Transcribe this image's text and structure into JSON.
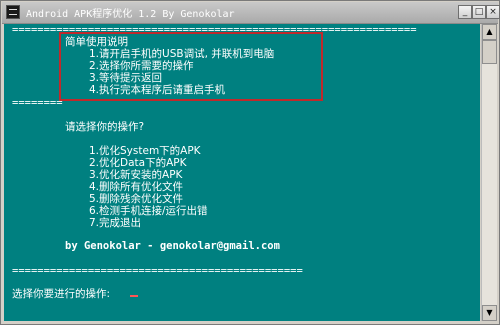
{
  "window": {
    "title": "Android APK程序优化 1.2 By Genokolar",
    "icon": "console-icon",
    "controls": {
      "minimize": "_",
      "maximize": "□",
      "close": "×"
    }
  },
  "console": {
    "separator_top": "================================================================",
    "instructions": {
      "heading": "简单使用说明",
      "steps": [
        "1.请开启手机的USB调试, 并联机到电脑",
        "2.选择你所需要的操作",
        "3.等待提示返回",
        "4.执行完本程序后请重启手机"
      ]
    },
    "separator_short": "========",
    "prompt_title": "请选择你的操作?",
    "options": [
      "1.优化System下的APK",
      "2.优化Data下的APK",
      "3.优化新安装的APK",
      "4.删除所有优化文件",
      "5.删除残余优化文件",
      "6.检测手机连接/运行出错",
      "7.完成退出"
    ],
    "author_line": "by Genokolar - genokolar@gmail.com",
    "separator_bottom": "==============================================",
    "input_prompt": "选择你要进行的操作:"
  },
  "colors": {
    "console_bg": "#008080",
    "highlight_box": "#c0292b",
    "text": "#ffffff"
  }
}
